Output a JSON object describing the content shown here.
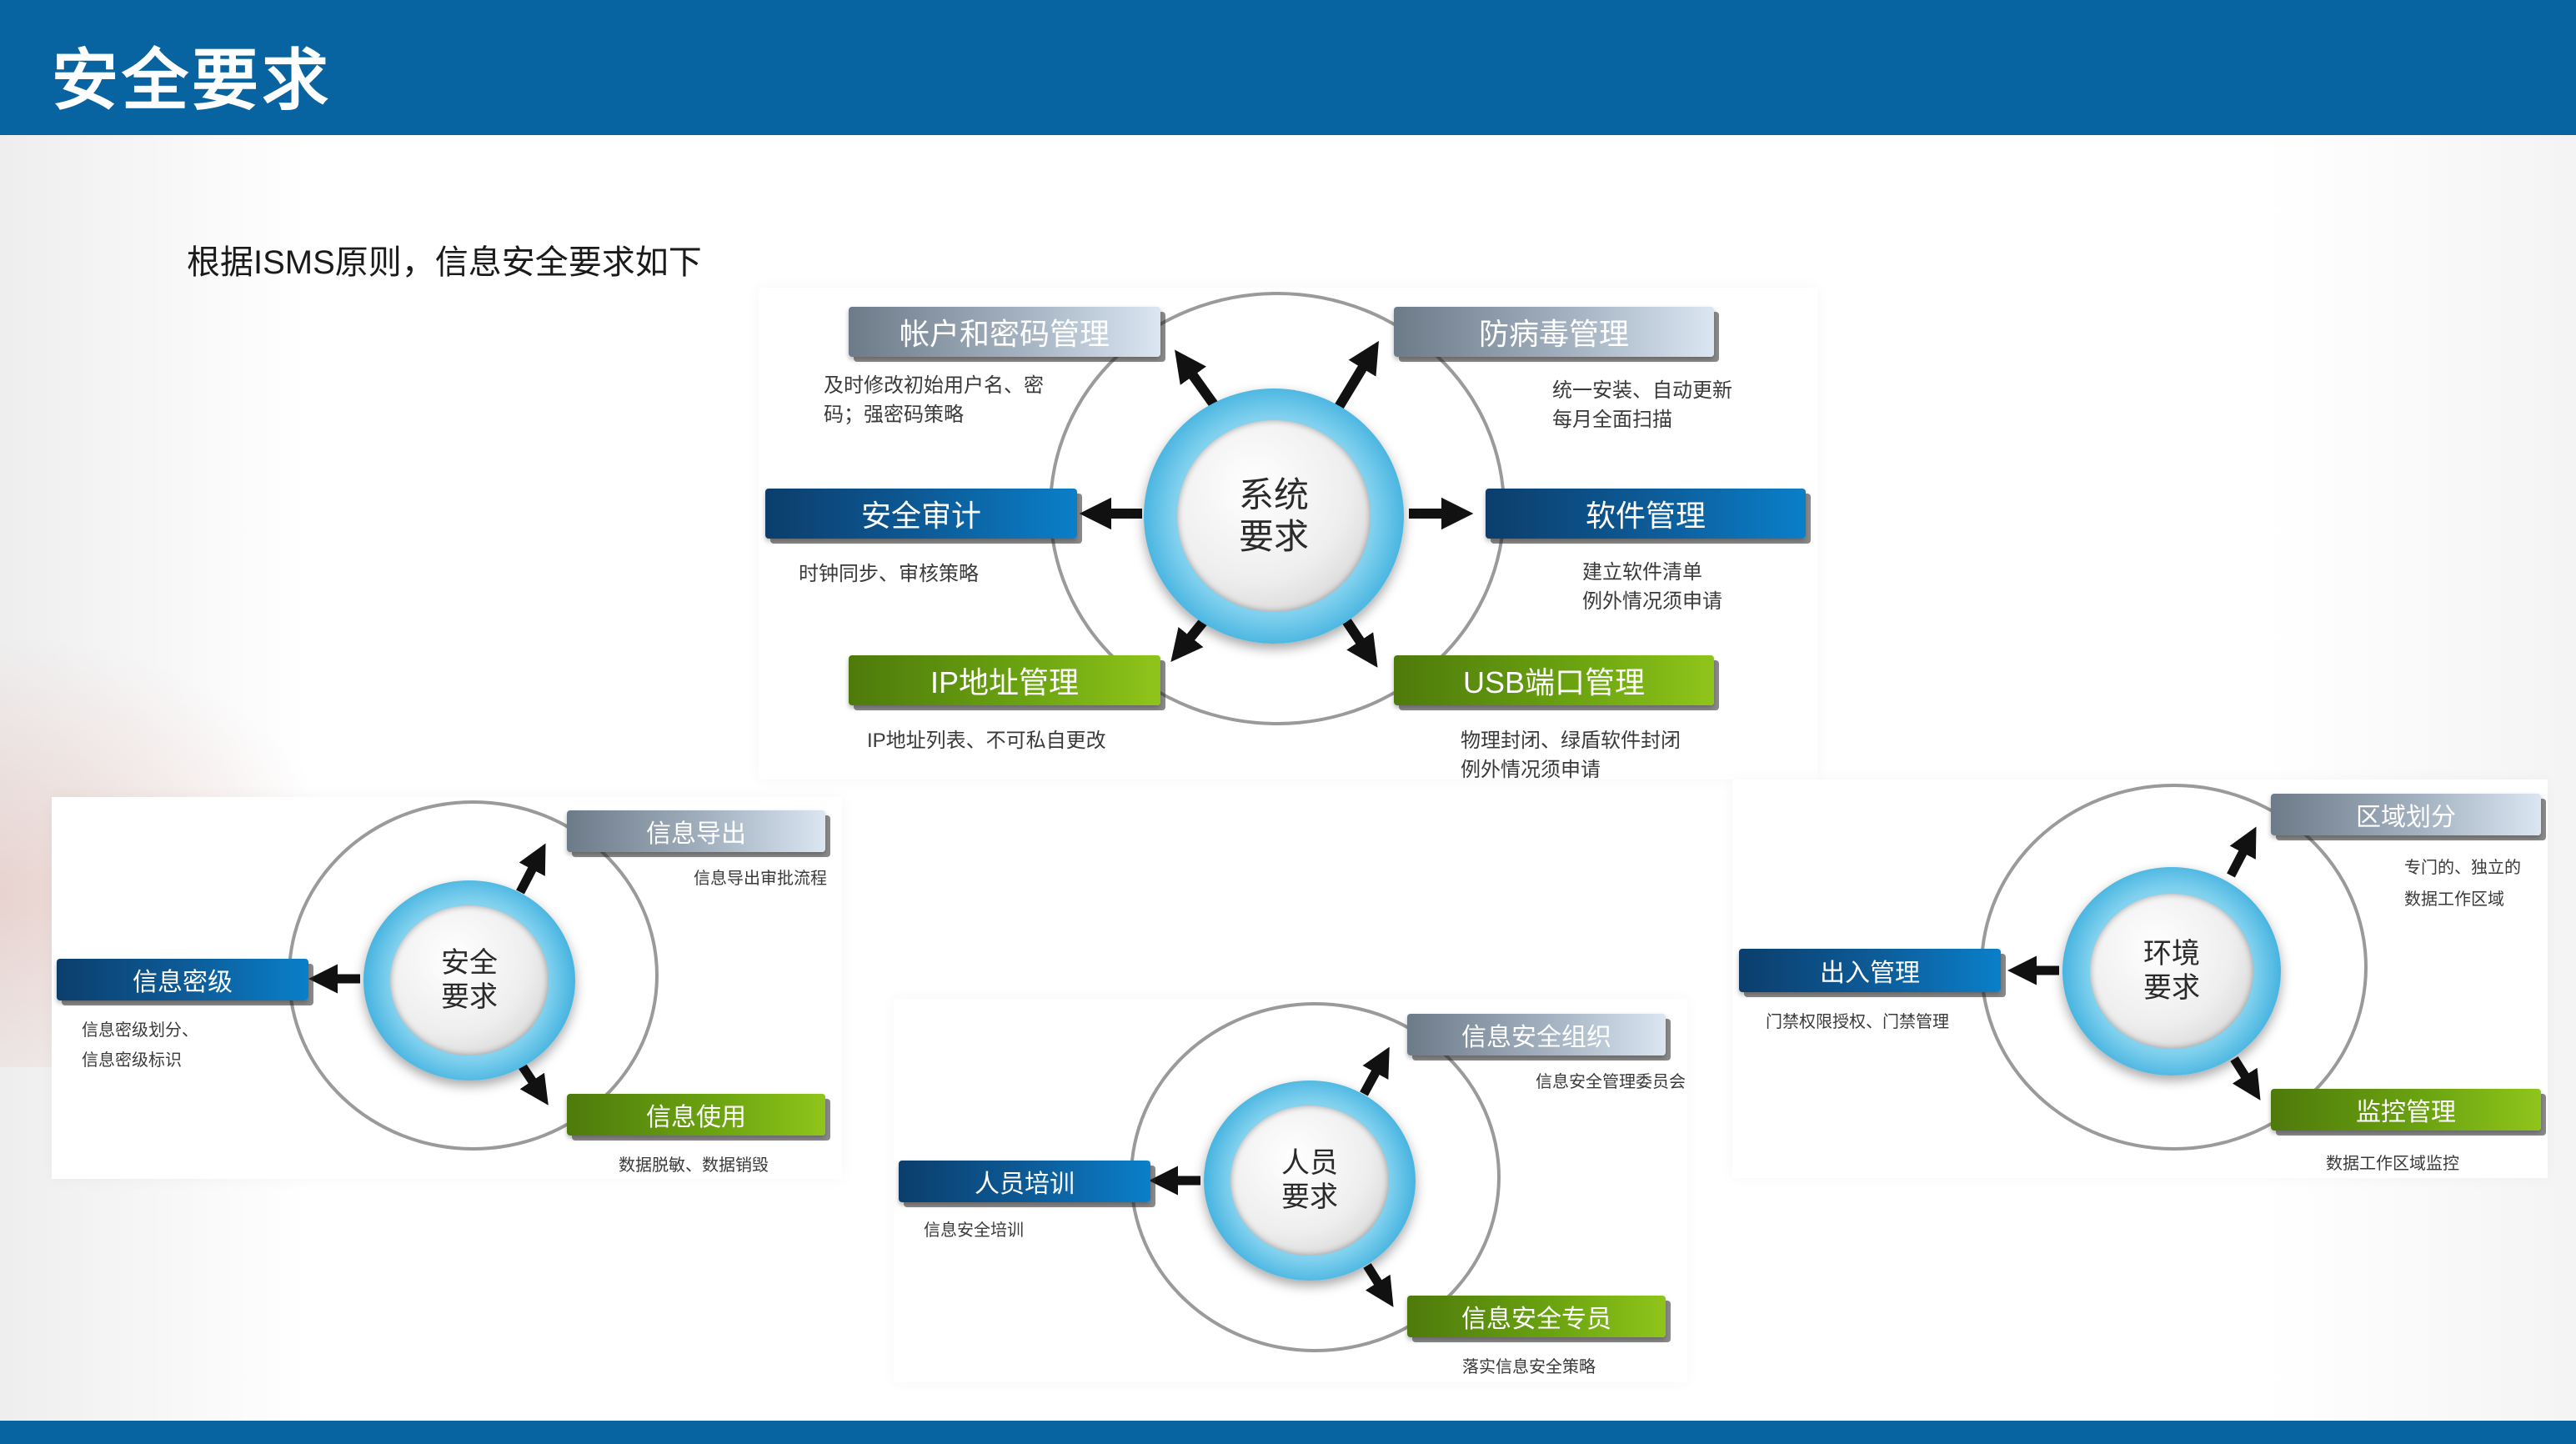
{
  "header": {
    "title": "安全要求"
  },
  "intro": "根据ISMS原则，信息安全要求如下",
  "system": {
    "center": [
      "系统",
      "要求"
    ],
    "nodes": {
      "account": {
        "label": "帐户和密码管理",
        "desc": [
          "及时修改初始用户名、密",
          "码；强密码策略"
        ]
      },
      "antivirus": {
        "label": "防病毒管理",
        "desc": [
          "统一安装、自动更新",
          "每月全面扫描"
        ]
      },
      "audit": {
        "label": "安全审计",
        "desc": [
          "时钟同步、审核策略"
        ]
      },
      "software": {
        "label": "软件管理",
        "desc": [
          "建立软件清单",
          "例外情况须申请"
        ]
      },
      "ip": {
        "label": "IP地址管理",
        "desc": [
          "IP地址列表、不可私自更改"
        ]
      },
      "usb": {
        "label": "USB端口管理",
        "desc": [
          "物理封闭、绿盾软件封闭",
          "例外情况须申请"
        ]
      }
    }
  },
  "security": {
    "center": [
      "安全",
      "要求"
    ],
    "nodes": {
      "export": {
        "label": "信息导出",
        "desc": [
          "信息导出审批流程"
        ]
      },
      "level": {
        "label": "信息密级",
        "desc": [
          "信息密级划分、",
          "信息密级标识"
        ]
      },
      "use": {
        "label": "信息使用",
        "desc": [
          "数据脱敏、数据销毁"
        ]
      }
    }
  },
  "personnel": {
    "center": [
      "人员",
      "要求"
    ],
    "nodes": {
      "org": {
        "label": "信息安全组织",
        "desc": [
          "信息安全管理委员会"
        ]
      },
      "training": {
        "label": "人员培训",
        "desc": [
          "信息安全培训"
        ]
      },
      "officer": {
        "label": "信息安全专员",
        "desc": [
          "落实信息安全策略"
        ]
      }
    }
  },
  "environment": {
    "center": [
      "环境",
      "要求"
    ],
    "nodes": {
      "zone": {
        "label": "区域划分",
        "desc": [
          "专门的、独立的",
          "数据工作区域"
        ]
      },
      "access": {
        "label": "出入管理",
        "desc": [
          "门禁权限授权、门禁管理"
        ]
      },
      "monitor": {
        "label": "监控管理",
        "desc": [
          "数据工作区域监控"
        ]
      }
    }
  }
}
